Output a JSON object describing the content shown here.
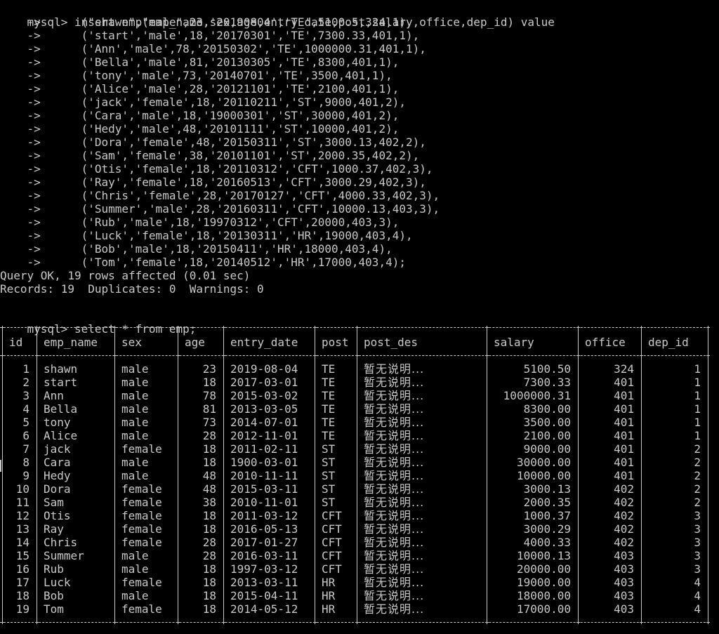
{
  "terminal": {
    "prompt": "mysql>",
    "continuation": "    ->",
    "insert_command": "insert emp(emp_name,sex,age,entry_date,post,salary,office,dep_id) value",
    "insert_values": [
      "(\"shawn\",\"male\",23,'20190804','TE',5100.5,324,1),",
      "('start','male',18,'20170301','TE',7300.33,401,1),",
      "('Ann','male',78,'20150302','TE',1000000.31,401,1),",
      "('Bella','male',81,'20130305','TE',8300,401,1),",
      "('tony','male',73,'20140701','TE',3500,401,1),",
      "('Alice','male',28,'20121101','TE',2100,401,1),",
      "('jack','female',18,'20110211','ST',9000,401,2),",
      "('Cara','male',18,'19000301','ST',30000,401,2),",
      "('Hedy','male',48,'20101111','ST',10000,401,2),",
      "('Dora','female',48,'20150311','ST',3000.13,402,2),",
      "('Sam','female',38,'20101101','ST',2000.35,402,2),",
      "('Otis','female',18,'20110312','CFT',1000.37,402,3),",
      "('Ray','female',18,'20160513','CFT',3000.29,402,3),",
      "('Chris','female',28,'20170127','CFT',4000.33,402,3),",
      "('Summer','male',28,'20160311','CFT',10000.13,403,3),",
      "('Rub','male',18,'19970312','CFT',20000,403,3),",
      "('Luck','female',18,'20130311','HR',19000,403,4),",
      "('Bob','male',18,'20150411','HR',18000,403,4),",
      "('Tom','female',18,'20140512','HR',17000,403,4);"
    ],
    "query_ok": "Query OK, 19 rows affected (0.01 sec)",
    "records": "Records: 19  Duplicates: 0  Warnings: 0",
    "select_command": "select * from emp;"
  },
  "table": {
    "columns": [
      "id",
      "emp_name",
      "sex",
      "age",
      "entry_date",
      "post",
      "post_des",
      "salary",
      "office",
      "dep_id"
    ],
    "rows": [
      [
        "1",
        "shawn",
        "male",
        "23",
        "2019-08-04",
        "TE",
        "暂无说明...",
        "5100.50",
        "324",
        "1"
      ],
      [
        "2",
        "start",
        "male",
        "18",
        "2017-03-01",
        "TE",
        "暂无说明...",
        "7300.33",
        "401",
        "1"
      ],
      [
        "3",
        "Ann",
        "male",
        "78",
        "2015-03-02",
        "TE",
        "暂无说明...",
        "1000000.31",
        "401",
        "1"
      ],
      [
        "4",
        "Bella",
        "male",
        "81",
        "2013-03-05",
        "TE",
        "暂无说明...",
        "8300.00",
        "401",
        "1"
      ],
      [
        "5",
        "tony",
        "male",
        "73",
        "2014-07-01",
        "TE",
        "暂无说明...",
        "3500.00",
        "401",
        "1"
      ],
      [
        "6",
        "Alice",
        "male",
        "28",
        "2012-11-01",
        "TE",
        "暂无说明...",
        "2100.00",
        "401",
        "1"
      ],
      [
        "7",
        "jack",
        "female",
        "18",
        "2011-02-11",
        "ST",
        "暂无说明...",
        "9000.00",
        "401",
        "2"
      ],
      [
        "8",
        "Cara",
        "male",
        "18",
        "1900-03-01",
        "ST",
        "暂无说明...",
        "30000.00",
        "401",
        "2"
      ],
      [
        "9",
        "Hedy",
        "male",
        "48",
        "2010-11-11",
        "ST",
        "暂无说明...",
        "10000.00",
        "401",
        "2"
      ],
      [
        "10",
        "Dora",
        "female",
        "48",
        "2015-03-11",
        "ST",
        "暂无说明...",
        "3000.13",
        "402",
        "2"
      ],
      [
        "11",
        "Sam",
        "female",
        "38",
        "2010-11-01",
        "ST",
        "暂无说明...",
        "2000.35",
        "402",
        "2"
      ],
      [
        "12",
        "Otis",
        "female",
        "18",
        "2011-03-12",
        "CFT",
        "暂无说明...",
        "1000.37",
        "402",
        "3"
      ],
      [
        "13",
        "Ray",
        "female",
        "18",
        "2016-05-13",
        "CFT",
        "暂无说明...",
        "3000.29",
        "402",
        "3"
      ],
      [
        "14",
        "Chris",
        "female",
        "28",
        "2017-01-27",
        "CFT",
        "暂无说明...",
        "4000.33",
        "402",
        "3"
      ],
      [
        "15",
        "Summer",
        "male",
        "28",
        "2016-03-11",
        "CFT",
        "暂无说明...",
        "10000.13",
        "403",
        "3"
      ],
      [
        "16",
        "Rub",
        "male",
        "18",
        "1997-03-12",
        "CFT",
        "暂无说明...",
        "20000.00",
        "403",
        "3"
      ],
      [
        "17",
        "Luck",
        "female",
        "18",
        "2013-03-11",
        "HR",
        "暂无说明...",
        "19000.00",
        "403",
        "4"
      ],
      [
        "18",
        "Bob",
        "male",
        "18",
        "2015-04-11",
        "HR",
        "暂无说明...",
        "18000.00",
        "403",
        "4"
      ],
      [
        "19",
        "Tom",
        "female",
        "18",
        "2014-05-12",
        "HR",
        "暂无说明...",
        "17000.00",
        "403",
        "4"
      ]
    ]
  },
  "colors": {
    "background": "#000000",
    "text": "#c8c8c8"
  }
}
